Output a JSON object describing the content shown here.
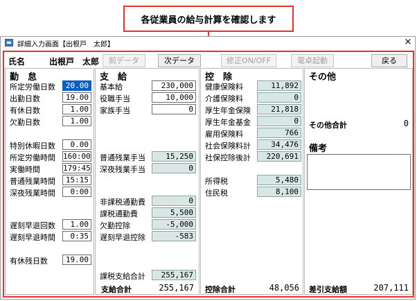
{
  "callout": "各従業員の給与計算を確認します",
  "window": {
    "title": "詳細入力画面【出根戸　太郎】",
    "close": "×"
  },
  "employee": {
    "label": "氏名",
    "name": "出根戸　太郎"
  },
  "toolbar": {
    "prev": "前データ",
    "next": "次データ",
    "toggle_edit": "修正ON/OFF",
    "calculator": "電卓起動",
    "back": "戻る"
  },
  "attendance": {
    "title": "勤　怠",
    "rows": [
      {
        "label": "所定労働日数",
        "value": "20.00"
      },
      {
        "label": "出勤日数",
        "value": "19.00"
      },
      {
        "label": "有休日数",
        "value": "1.00"
      },
      {
        "label": "欠勤日数",
        "value": "1.00"
      },
      {
        "label": "特別休暇日数",
        "value": "0.00"
      },
      {
        "label": "所定労働時間",
        "value": "160:00"
      },
      {
        "label": "実働時間",
        "value": "179:45"
      },
      {
        "label": "普通残業時間",
        "value": "15:15"
      },
      {
        "label": "深夜残業時間",
        "value": "0:00"
      },
      {
        "label": "遅刻早退回数",
        "value": "1.00"
      },
      {
        "label": "遅刻早退時間",
        "value": "0:35"
      },
      {
        "label": "有休残日数",
        "value": "19.00"
      }
    ]
  },
  "payment": {
    "title": "支　給",
    "rows": [
      {
        "label": "基本給",
        "value": "230,000"
      },
      {
        "label": "役職手当",
        "value": "10,000"
      },
      {
        "label": "家族手当",
        "value": "0"
      },
      {
        "label": "普通残業手当",
        "value": "15,250"
      },
      {
        "label": "深夜残業手当",
        "value": "0"
      },
      {
        "label": "非課税通勤費",
        "value": "0"
      },
      {
        "label": "課税通勤費",
        "value": "5,500"
      },
      {
        "label": "欠勤控除",
        "value": "-5,000"
      },
      {
        "label": "遅刻早退控除",
        "value": "-583"
      },
      {
        "label": "課税支給合計",
        "value": "255,167"
      }
    ],
    "total_label": "支給合計",
    "total": "255,167"
  },
  "deduction": {
    "title": "控　除",
    "rows": [
      {
        "label": "健康保険料",
        "value": "11,892"
      },
      {
        "label": "介護保険料",
        "value": "0"
      },
      {
        "label": "厚生年金保険",
        "value": "21,818"
      },
      {
        "label": "厚生年金基金",
        "value": "0"
      },
      {
        "label": "雇用保険料",
        "value": "766"
      },
      {
        "label": "社会保険料計",
        "value": "34,476"
      },
      {
        "label": "社保控除後計",
        "value": "220,691"
      },
      {
        "label": "所得税",
        "value": "5,480"
      },
      {
        "label": "住民税",
        "value": "8,100"
      }
    ],
    "total_label": "控除合計",
    "total": "48,056"
  },
  "other": {
    "title": "その他",
    "total_label": "その他合計",
    "total": "0",
    "memo_label": "備考",
    "net_label": "差引支給額",
    "net": "207,111"
  }
}
